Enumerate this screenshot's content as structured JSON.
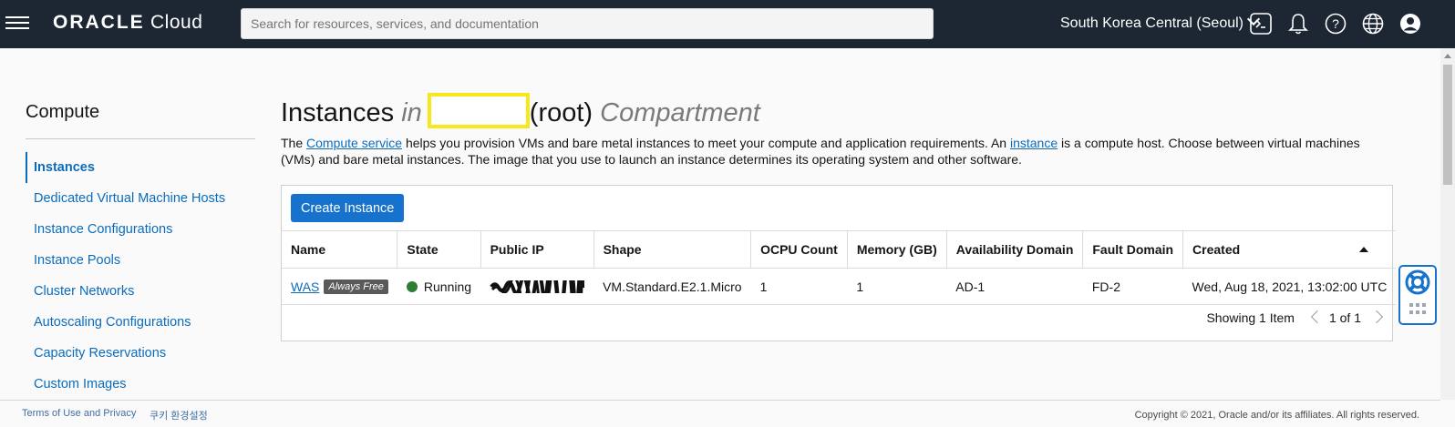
{
  "header": {
    "logo_brand": "ORACLE",
    "logo_product": "Cloud",
    "search_placeholder": "Search for resources, services, and documentation",
    "region": "South Korea Central (Seoul)",
    "icons": [
      "menu-icon",
      "cloud-shell-icon",
      "bell-icon",
      "help-icon",
      "globe-icon",
      "user-icon"
    ]
  },
  "sidebar": {
    "title": "Compute",
    "items": [
      {
        "label": "Instances",
        "active": true
      },
      {
        "label": "Dedicated Virtual Machine Hosts"
      },
      {
        "label": "Instance Configurations"
      },
      {
        "label": "Instance Pools"
      },
      {
        "label": "Cluster Networks"
      },
      {
        "label": "Autoscaling Configurations"
      },
      {
        "label": "Capacity Reservations"
      },
      {
        "label": "Custom Images"
      }
    ]
  },
  "main": {
    "title_prefix": "Instances",
    "title_in": "in",
    "title_root": "(root)",
    "title_suffix": "Compartment",
    "desc_1": "The ",
    "desc_link_1": "Compute service",
    "desc_2": " helps you provision VMs and bare metal instances to meet your compute and application requirements. An ",
    "desc_link_2": "instance",
    "desc_3": " is a compute host. Choose between virtual machines (VMs) and bare metal instances. The image that you use to launch an instance determines its operating system and other software.",
    "create_button": "Create Instance",
    "columns": [
      "Name",
      "State",
      "Public IP",
      "Shape",
      "OCPU Count",
      "Memory (GB)",
      "Availability Domain",
      "Fault Domain",
      "Created"
    ],
    "rows": [
      {
        "name": "WAS",
        "badge": "Always Free",
        "state": "Running",
        "shape": "VM.Standard.E2.1.Micro",
        "ocpu": "1",
        "memory": "1",
        "ad": "AD-1",
        "fd": "FD-2",
        "created": "Wed, Aug 18, 2021, 13:02:00 UTC"
      }
    ],
    "showing": "Showing 1 Item",
    "page": "1 of 1"
  },
  "footer": {
    "terms": "Terms of Use and Privacy",
    "cookies": "쿠키 환경설정",
    "copyright": "Copyright © 2021, Oracle and/or its affiliates. All rights reserved."
  },
  "colors": {
    "header_bg": "#1d2733",
    "link": "#0c6cbc",
    "primary_button": "#1672cc",
    "running": "#2e7d32",
    "highlight": "#f8e71c"
  }
}
